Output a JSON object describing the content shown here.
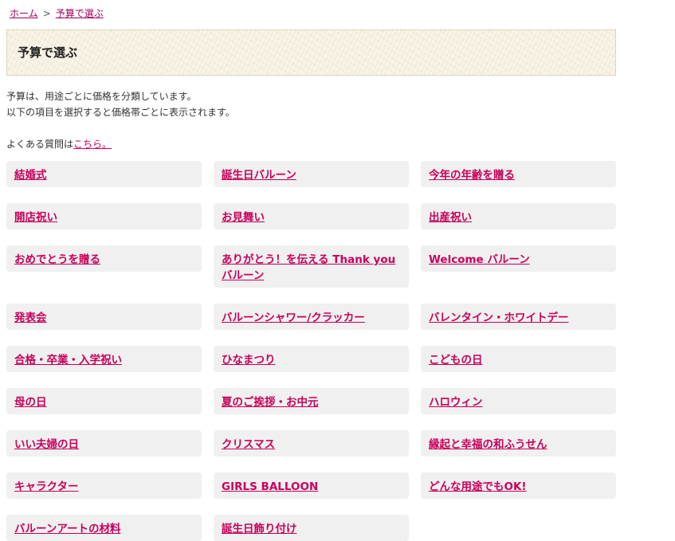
{
  "breadcrumb": {
    "home": "ホーム",
    "separator": ">",
    "current": "予算で選ぶ"
  },
  "page_title": "予算で選ぶ",
  "intro": {
    "line1": "予算は、用途ごとに価格を分類しています。",
    "line2": "以下の項目を選択すると価格帯ごとに表示されます。"
  },
  "faq": {
    "prefix": "よくある質問は",
    "link": "こちら。"
  },
  "categories": [
    {
      "label": "結婚式"
    },
    {
      "label": "誕生日バルーン"
    },
    {
      "label": "今年の年齢を贈る"
    },
    {
      "label": "開店祝い"
    },
    {
      "label": "お見舞い"
    },
    {
      "label": "出産祝い"
    },
    {
      "label": "おめでとうを贈る"
    },
    {
      "label": "ありがとう！を伝える Thank you バルーン"
    },
    {
      "label": "Welcome バルーン"
    },
    {
      "label": "発表会"
    },
    {
      "label": "バルーンシャワー/クラッカー"
    },
    {
      "label": "バレンタイン・ホワイトデー"
    },
    {
      "label": "合格・卒業・入学祝い"
    },
    {
      "label": "ひなまつり"
    },
    {
      "label": "こどもの日"
    },
    {
      "label": "母の日"
    },
    {
      "label": "夏のご挨拶・お中元"
    },
    {
      "label": "ハロウィン"
    },
    {
      "label": "いい夫婦の日"
    },
    {
      "label": "クリスマス"
    },
    {
      "label": "縁起と幸福の和ふうせん"
    },
    {
      "label": "キャラクター"
    },
    {
      "label": "GIRLS BALLOON"
    },
    {
      "label": "どんな用途でもOK!"
    },
    {
      "label": "バルーンアートの材料"
    },
    {
      "label": "誕生日飾り付け"
    }
  ],
  "colors": {
    "link": "#c8005a",
    "cell_bg": "#f0f0f0",
    "title_bg": "#f6f1e3"
  }
}
